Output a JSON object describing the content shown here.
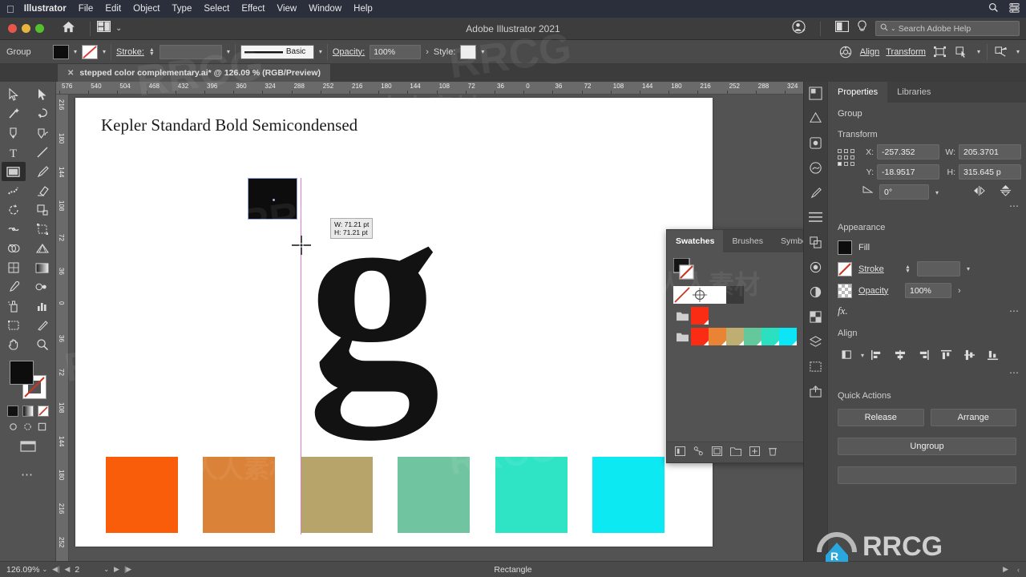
{
  "macmenu": {
    "apple_icon": "apple-icon",
    "items": [
      {
        "label": "Illustrator",
        "bold": true
      },
      {
        "label": "File",
        "bold": false
      },
      {
        "label": "Edit",
        "bold": false
      },
      {
        "label": "Object",
        "bold": false
      },
      {
        "label": "Type",
        "bold": false
      },
      {
        "label": "Select",
        "bold": false
      },
      {
        "label": "Effect",
        "bold": false
      },
      {
        "label": "View",
        "bold": false
      },
      {
        "label": "Window",
        "bold": false
      },
      {
        "label": "Help",
        "bold": false
      }
    ],
    "right_icons": [
      "spotlight-search-icon",
      "control-center-icon"
    ]
  },
  "titlebar": {
    "title": "Adobe Illustrator 2021",
    "home_icon": "home-icon",
    "arrange_icon": "arrange-documents-icon",
    "arrange_caret": "⌄",
    "account_icon": "account-icon",
    "screenmode_icon": "screen-mode-icon",
    "tips_icon": "lightbulb-icon",
    "search": {
      "placeholder": "Search Adobe Help",
      "icon": "search-icon",
      "caret": "⌄"
    }
  },
  "controlbar": {
    "selection_label": "Group",
    "fill_color": "#0d0d0d",
    "stroke_label": "Stroke:",
    "stroke_none": true,
    "stroke_weight": "",
    "brush_label": "Basic",
    "opacity_label": "Opacity:",
    "opacity_value": "100%",
    "opacity_arrow": "›",
    "style_label": "Style:",
    "align_label": "Align",
    "transform_label": "Transform",
    "icons": [
      "document-setup-icon",
      "align-objects-icon",
      "select-similar-icon",
      "isolate-icon"
    ]
  },
  "document_tab": {
    "close_icon": "close-icon",
    "title": "stepped color complementary.ai* @ 126.09 % (RGB/Preview)"
  },
  "toolbar": {
    "tools": [
      {
        "name": "selection-tool"
      },
      {
        "name": "direct-selection-tool"
      },
      {
        "name": "magic-wand-tool"
      },
      {
        "name": "lasso-tool"
      },
      {
        "name": "pen-tool"
      },
      {
        "name": "curvature-tool"
      },
      {
        "name": "type-tool"
      },
      {
        "name": "line-segment-tool"
      },
      {
        "name": "rectangle-tool",
        "active": true
      },
      {
        "name": "paintbrush-tool"
      },
      {
        "name": "shaper-tool"
      },
      {
        "name": "eraser-tool"
      },
      {
        "name": "rotate-tool"
      },
      {
        "name": "scale-tool"
      },
      {
        "name": "width-tool"
      },
      {
        "name": "free-transform-tool"
      },
      {
        "name": "shape-builder-tool"
      },
      {
        "name": "perspective-grid-tool"
      },
      {
        "name": "mesh-tool"
      },
      {
        "name": "gradient-tool"
      },
      {
        "name": "eyedropper-tool"
      },
      {
        "name": "blend-tool"
      },
      {
        "name": "symbol-sprayer-tool"
      },
      {
        "name": "column-graph-tool"
      },
      {
        "name": "artboard-tool"
      },
      {
        "name": "slice-tool"
      },
      {
        "name": "hand-tool"
      },
      {
        "name": "zoom-tool"
      }
    ],
    "fill_color": "#0d0d0d",
    "stroke_color": "#ffffff",
    "more_icon": "more-tools-icon",
    "screen_icon": "change-screen-mode-icon"
  },
  "rulers": {
    "horizontal_ticks": [
      "576",
      "540",
      "504",
      "468",
      "432",
      "396",
      "360",
      "324",
      "288",
      "252",
      "216",
      "180",
      "144",
      "108",
      "72",
      "36",
      "0",
      "36",
      "72",
      "108",
      "144",
      "180",
      "216",
      "252",
      "288",
      "324"
    ],
    "vertical_ticks": [
      "216",
      "180",
      "144",
      "108",
      "72",
      "36",
      "0",
      "36",
      "72",
      "108",
      "144",
      "180",
      "216",
      "252"
    ]
  },
  "canvas": {
    "heading": "Kepler Standard Bold Semicondensed",
    "glyph": "g",
    "dimension_tooltip": {
      "width": "W: 71.21 pt",
      "height": "H: 71.21 pt"
    },
    "selected_rect_color": "#0d0d0d",
    "guide_color": "#e07ad0",
    "color_squares": [
      {
        "name": "swatch-orange-red",
        "color": "#f95d0a"
      },
      {
        "name": "swatch-orange",
        "color": "#db8239"
      },
      {
        "name": "swatch-khaki",
        "color": "#b7a46b"
      },
      {
        "name": "swatch-sea-green",
        "color": "#71c4a0"
      },
      {
        "name": "swatch-turquoise",
        "color": "#2fe3c5"
      },
      {
        "name": "swatch-cyan",
        "color": "#0ce9f2"
      }
    ]
  },
  "swatches_panel": {
    "tabs": [
      {
        "label": "Swatches",
        "active": true
      },
      {
        "label": "Brushes",
        "active": false
      },
      {
        "label": "Symbols",
        "active": false
      }
    ],
    "collapse_icon": "»",
    "menu_icon": "panel-menu-icon",
    "view_list_icon": "list-view-icon",
    "view_grid_icon": "grid-view-icon",
    "row1": [
      {
        "name": "swatch-none",
        "color": "none"
      },
      {
        "name": "swatch-registration",
        "color": "registration"
      },
      {
        "name": "swatch-white",
        "color": "#ffffff"
      },
      {
        "name": "swatch-black",
        "color": "#3a3a3a"
      }
    ],
    "row2_folder": "color-group-folder-icon",
    "row2": [
      {
        "name": "swatch-red",
        "color": "#fa2d14"
      }
    ],
    "row3_folder": "color-group-folder-icon",
    "row3": [
      {
        "name": "swatch-red-2",
        "color": "#fa2d14"
      },
      {
        "name": "swatch-orange-2",
        "color": "#e88434"
      },
      {
        "name": "swatch-khaki-2",
        "color": "#bfae72"
      },
      {
        "name": "swatch-green-2",
        "color": "#63c89c"
      },
      {
        "name": "swatch-turquoise-2",
        "color": "#2ae0c0"
      },
      {
        "name": "swatch-cyan-2",
        "color": "#0ce5f5"
      }
    ],
    "footer_icons": [
      "swatch-libraries-icon",
      "show-swatch-kinds-icon",
      "swatch-options-icon",
      "new-color-group-icon",
      "new-swatch-icon",
      "delete-swatch-icon"
    ]
  },
  "icon_rail": [
    "color-icon",
    "color-guide-icon",
    "libraries-icon",
    "symbols-icon",
    "brushes-icon",
    "align-panel-icon",
    "pathfinder-icon",
    "appearance-icon",
    "graphic-styles-icon",
    "transparency-icon",
    "layers-icon",
    "artboards-icon",
    "asset-export-icon"
  ],
  "properties_panel": {
    "tabs": [
      {
        "label": "Properties",
        "active": true
      },
      {
        "label": "Libraries",
        "active": false
      }
    ],
    "selection_type": "Group",
    "transform": {
      "title": "Transform",
      "x_label": "X:",
      "x_value": "-257.352",
      "y_label": "Y:",
      "y_value": "-18.9517",
      "w_label": "W:",
      "w_value": "205.3701",
      "h_label": "H:",
      "h_value": "315.645 p",
      "angle_label": "∠:",
      "angle_value": "0°",
      "link_icon": "constrain-proportions-icon",
      "flip_h_icon": "flip-horizontal-icon",
      "flip_v_icon": "flip-vertical-icon",
      "more_icon": "more-options-icon"
    },
    "appearance": {
      "title": "Appearance",
      "fill_label": "Fill",
      "fill_color": "#0d0d0d",
      "stroke_label": "Stroke",
      "stroke_value": "",
      "opacity_label": "Opacity",
      "opacity_value": "100%",
      "opacity_arrow": "›",
      "fx_label": "fx.",
      "more_icon": "more-options-icon"
    },
    "align": {
      "title": "Align",
      "buttons": [
        "align-to-icon",
        "align-left-icon",
        "align-center-h-icon",
        "align-right-icon",
        "align-top-icon",
        "align-center-v-icon",
        "align-bottom-icon"
      ],
      "more_icon": "more-options-icon"
    },
    "quick_actions": {
      "title": "Quick Actions",
      "release": "Release",
      "arrange": "Arrange",
      "ungroup": "Ungroup"
    }
  },
  "statusbar": {
    "zoom": "126.09%",
    "zoom_caret": "⌄",
    "first_icon": "⏮",
    "prev_icon": "◀",
    "page": "2",
    "page_caret": "⌄",
    "next_icon": "▶",
    "last_icon": "⏭",
    "tool_name": "Rectangle",
    "right_icon": "▶",
    "resize_icon": "‹"
  },
  "watermarks": {
    "text1": "RRCG",
    "text2": "人人素材"
  }
}
